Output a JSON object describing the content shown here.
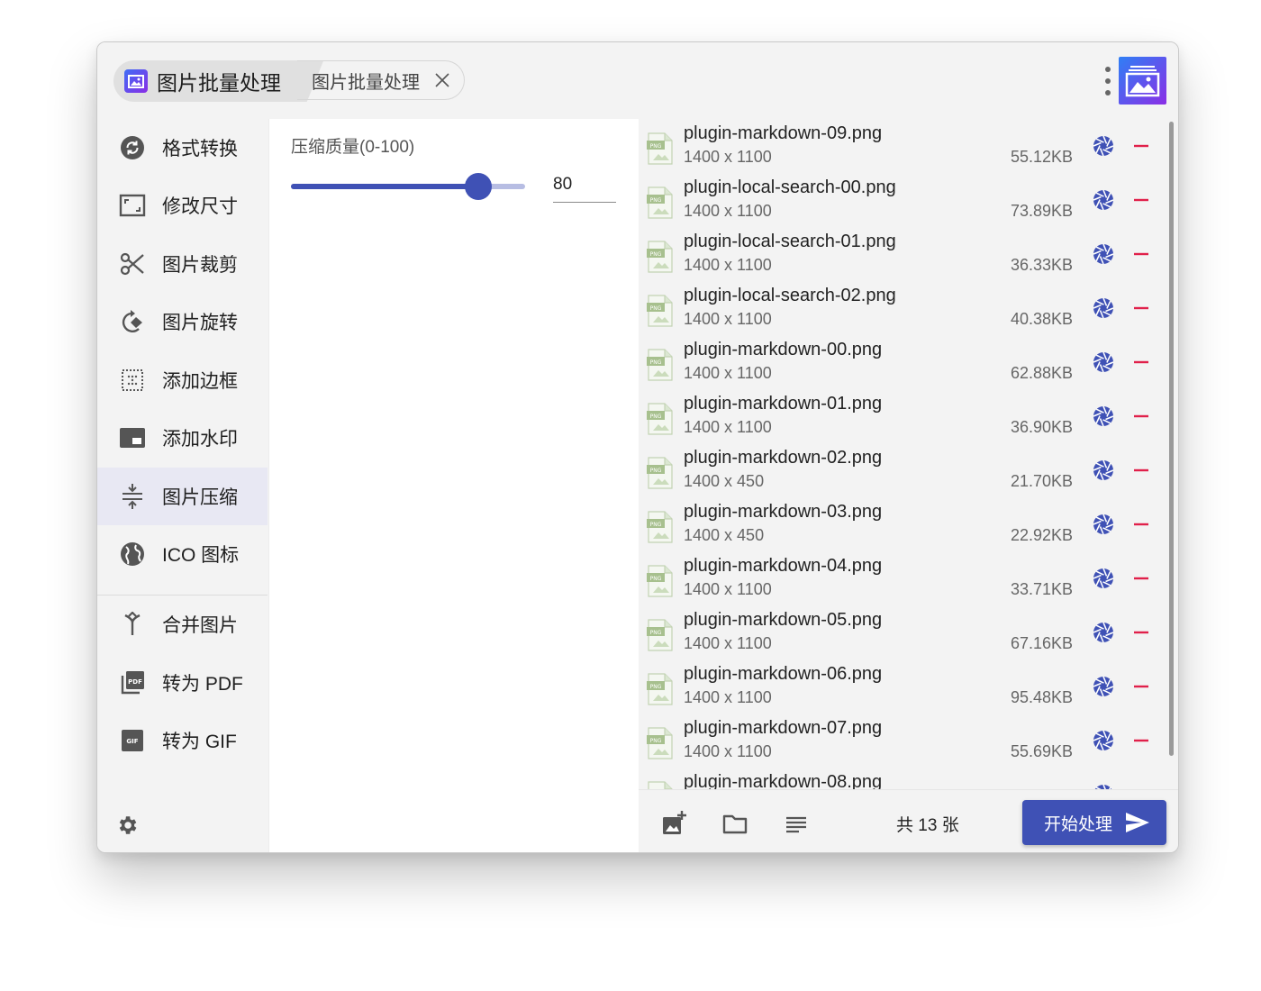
{
  "tabs": [
    {
      "label": "图片批量处理",
      "active": true
    },
    {
      "label": "图片批量处理",
      "active": false
    }
  ],
  "sidebar": {
    "items": [
      {
        "label": "格式转换",
        "icon": "convert-icon"
      },
      {
        "label": "修改尺寸",
        "icon": "resize-icon"
      },
      {
        "label": "图片裁剪",
        "icon": "scissors-icon"
      },
      {
        "label": "图片旋转",
        "icon": "rotate-icon"
      },
      {
        "label": "添加边框",
        "icon": "border-icon"
      },
      {
        "label": "添加水印",
        "icon": "watermark-icon"
      },
      {
        "label": "图片压缩",
        "icon": "compress-icon",
        "active": true
      },
      {
        "label": "ICO 图标",
        "icon": "globe-icon"
      }
    ],
    "extra_items": [
      {
        "label": "合并图片",
        "icon": "merge-icon"
      },
      {
        "label": "转为 PDF",
        "icon": "pdf-icon"
      },
      {
        "label": "转为 GIF",
        "icon": "gif-icon"
      }
    ]
  },
  "compress": {
    "label": "压缩质量(0-100)",
    "value": "80",
    "slider_fraction": 0.8
  },
  "files": [
    {
      "name": "plugin-markdown-09.png",
      "dim": "1400 x 1100",
      "size": "55.12KB"
    },
    {
      "name": "plugin-local-search-00.png",
      "dim": "1400 x 1100",
      "size": "73.89KB"
    },
    {
      "name": "plugin-local-search-01.png",
      "dim": "1400 x 1100",
      "size": "36.33KB"
    },
    {
      "name": "plugin-local-search-02.png",
      "dim": "1400 x 1100",
      "size": "40.38KB"
    },
    {
      "name": "plugin-markdown-00.png",
      "dim": "1400 x 1100",
      "size": "62.88KB"
    },
    {
      "name": "plugin-markdown-01.png",
      "dim": "1400 x 1100",
      "size": "36.90KB"
    },
    {
      "name": "plugin-markdown-02.png",
      "dim": "1400 x 450",
      "size": "21.70KB"
    },
    {
      "name": "plugin-markdown-03.png",
      "dim": "1400 x 450",
      "size": "22.92KB"
    },
    {
      "name": "plugin-markdown-04.png",
      "dim": "1400 x 1100",
      "size": "33.71KB"
    },
    {
      "name": "plugin-markdown-05.png",
      "dim": "1400 x 1100",
      "size": "67.16KB"
    },
    {
      "name": "plugin-markdown-06.png",
      "dim": "1400 x 1100",
      "size": "95.48KB"
    },
    {
      "name": "plugin-markdown-07.png",
      "dim": "1400 x 1100",
      "size": "55.69KB"
    },
    {
      "name": "plugin-markdown-08.png",
      "dim": "",
      "size": ""
    }
  ],
  "footer": {
    "count_text": "共 13 张",
    "start_label": "开始处理"
  },
  "colors": {
    "accent": "#3f51b5",
    "remove": "#e0204a",
    "slider_track": "#b7bde3"
  }
}
